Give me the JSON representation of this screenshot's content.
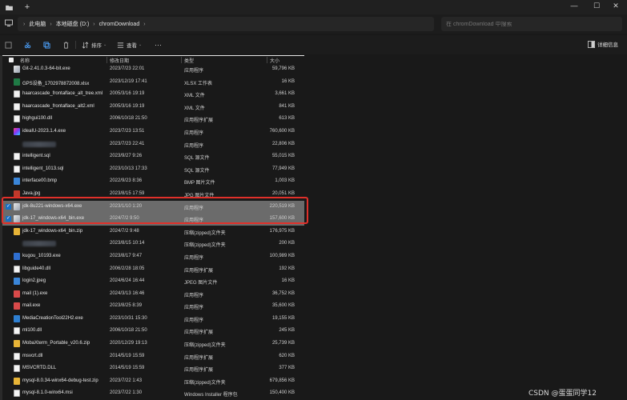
{
  "window": {
    "new_tab": "+",
    "controls": {
      "minimize": "—",
      "maximize": "☐",
      "close": "✕"
    }
  },
  "address": {
    "crumbs": [
      "此电脑",
      "本地磁盘 (D:)",
      "chromDownload"
    ],
    "search_placeholder": "在 chromDownload 中搜索"
  },
  "toolbar": {
    "sort_label": "排序",
    "view_label": "查看",
    "more_label": "···",
    "details_label": "详细信息"
  },
  "columns": {
    "name": "名称",
    "date": "修改日期",
    "type": "类型",
    "size": "大小"
  },
  "files": [
    {
      "name": "Git-2.41.0.3-64-bit.exe",
      "date": "2023/7/23 22:01",
      "type": "应用程序",
      "size": "59,796 KB",
      "icon": "exe"
    },
    {
      "name": "GPS设备_1702978872008.xlsx",
      "date": "2023/12/19 17:41",
      "type": "XLSX 工作表",
      "size": "16 KB",
      "icon": "xlsx"
    },
    {
      "name": "haarcascade_frontalface_alt_tree.xml",
      "date": "2005/3/16 19:19",
      "type": "XML 文件",
      "size": "3,661 KB",
      "icon": "xml"
    },
    {
      "name": "haarcascade_frontalface_alt2.xml",
      "date": "2005/3/16 19:19",
      "type": "XML 文件",
      "size": "841 KB",
      "icon": "xml"
    },
    {
      "name": "highgui100.dll",
      "date": "2006/10/18 21:50",
      "type": "应用程序扩展",
      "size": "613 KB",
      "icon": "dll"
    },
    {
      "name": "ideaIU-2023.1.4.exe",
      "date": "2023/7/23 13:51",
      "type": "应用程序",
      "size": "760,600 KB",
      "icon": "idea"
    },
    {
      "name": "",
      "date": "2023/7/23 22:41",
      "type": "应用程序",
      "size": "22,806 KB",
      "icon": "blur",
      "blurred": true
    },
    {
      "name": "intelligent.sql",
      "date": "2023/9/27 9:26",
      "type": "SQL 源文件",
      "size": "55,015 KB",
      "icon": "sql"
    },
    {
      "name": "intelligent_1013.sql",
      "date": "2023/10/13 17:33",
      "type": "SQL 源文件",
      "size": "77,949 KB",
      "icon": "sql"
    },
    {
      "name": "interface00.bmp",
      "date": "2022/9/23 8:36",
      "type": "BMP 图片文件",
      "size": "1,003 KB",
      "icon": "bmp"
    },
    {
      "name": "Java.jpg",
      "date": "2023/8/15 17:59",
      "type": "JPG 图片文件",
      "size": "20,051 KB",
      "icon": "java"
    },
    {
      "name": "jdk-8u221-windows-x64.exe",
      "date": "2023/1/10 1:20",
      "type": "应用程序",
      "size": "220,519 KB",
      "icon": "exe",
      "selected": true
    },
    {
      "name": "jdk-17_windows-x64_bin.exe",
      "date": "2024/7/2 9:50",
      "type": "应用程序",
      "size": "157,600 KB",
      "icon": "exe",
      "selected": true
    },
    {
      "name": "jdk-17_windows-x64_bin.zip",
      "date": "2024/7/2 9:48",
      "type": "压缩(zipped)文件夹",
      "size": "176,975 KB",
      "icon": "zip"
    },
    {
      "name": "",
      "date": "2023/8/15 10:14",
      "type": "压缩(zipped)文件夹",
      "size": "200 KB",
      "icon": "blur",
      "blurred": true
    },
    {
      "name": "kugou_10193.exe",
      "date": "2023/8/17 9:47",
      "type": "应用程序",
      "size": "100,989 KB",
      "icon": "kugou"
    },
    {
      "name": "libguide40.dll",
      "date": "2006/2/28 18:05",
      "type": "应用程序扩展",
      "size": "192 KB",
      "icon": "dll"
    },
    {
      "name": "login2.jpeg",
      "date": "2024/6/24 16:44",
      "type": "JPEG 图片文件",
      "size": "16 KB",
      "icon": "jpg"
    },
    {
      "name": "mail (1).exe",
      "date": "2024/3/13 16:46",
      "type": "应用程序",
      "size": "36,752 KB",
      "icon": "mail"
    },
    {
      "name": "mail.exe",
      "date": "2023/8/25 8:39",
      "type": "应用程序",
      "size": "35,600 KB",
      "icon": "mail"
    },
    {
      "name": "MediaCreationTool22H2.exe",
      "date": "2023/10/31 15:30",
      "type": "应用程序",
      "size": "19,155 KB",
      "icon": "media"
    },
    {
      "name": "ml100.dll",
      "date": "2006/10/18 21:50",
      "type": "应用程序扩展",
      "size": "245 KB",
      "icon": "dll"
    },
    {
      "name": "MobaXterm_Portable_v20.6.zip",
      "date": "2020/12/29 19:13",
      "type": "压缩(zipped)文件夹",
      "size": "25,739 KB",
      "icon": "zip"
    },
    {
      "name": "msvcrt.dll",
      "date": "2014/5/19 15:59",
      "type": "应用程序扩展",
      "size": "620 KB",
      "icon": "dll"
    },
    {
      "name": "MSVCRTD.DLL",
      "date": "2014/5/19 15:59",
      "type": "应用程序扩展",
      "size": "377 KB",
      "icon": "dll"
    },
    {
      "name": "mysql-8.0.34-winx64-debug-test.zip",
      "date": "2023/7/22 1:43",
      "type": "压缩(zipped)文件夹",
      "size": "679,856 KB",
      "icon": "mysql"
    },
    {
      "name": "mysql-8.1.0-winx64.msi",
      "date": "2023/7/22 1:30",
      "type": "Windows Installer 程序包",
      "size": "150,400 KB",
      "icon": "dll"
    }
  ],
  "watermark": "CSDN @蛋蛋同学12"
}
